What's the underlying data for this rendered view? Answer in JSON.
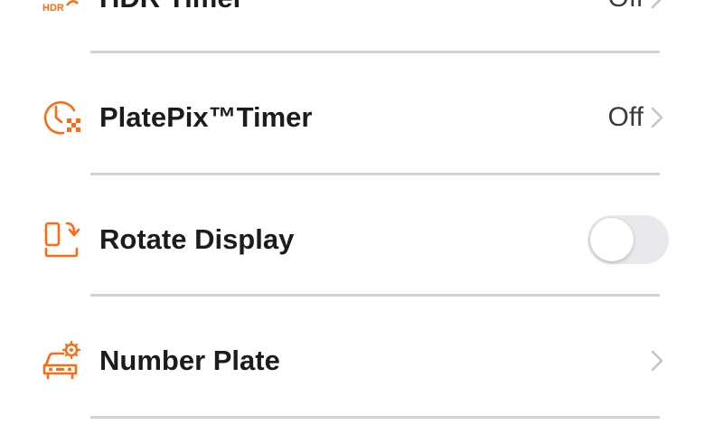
{
  "accent_color": "#ff6a13",
  "settings": {
    "items": [
      {
        "label": "HDR Timer",
        "value": "Off",
        "icon": "hdr-timer-icon",
        "control": "disclosure"
      },
      {
        "label": "PlatePix™Timer",
        "value": "Off",
        "icon": "platepix-timer-icon",
        "control": "disclosure"
      },
      {
        "label": "Rotate Display",
        "value": "",
        "icon": "rotate-display-icon",
        "control": "toggle",
        "toggle_on": false
      },
      {
        "label": "Number Plate",
        "value": "",
        "icon": "number-plate-icon",
        "control": "disclosure"
      }
    ]
  }
}
